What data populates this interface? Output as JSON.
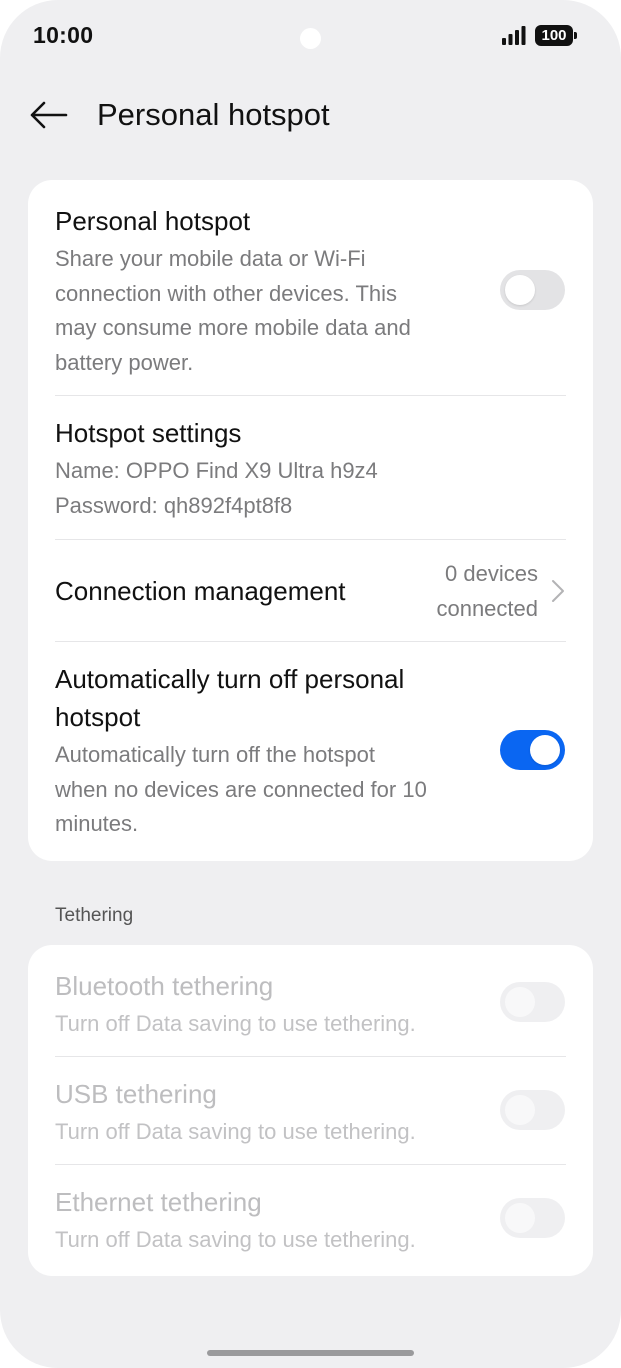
{
  "status_bar": {
    "time": "10:00",
    "battery": "100"
  },
  "header": {
    "title": "Personal hotspot"
  },
  "main": {
    "hotspot": {
      "title": "Personal hotspot",
      "description_lines": [
        "Share your mobile data or Wi-Fi",
        "connection with other devices. This",
        "may consume more mobile data and",
        "battery power."
      ],
      "enabled": false
    },
    "settings": {
      "title": "Hotspot settings",
      "name_line": "Name: OPPO Find X9 Ultra h9z4",
      "password_line": "Password: qh892f4pt8f8"
    },
    "connection": {
      "title": "Connection management",
      "value_lines": [
        "0 devices",
        "connected"
      ]
    },
    "auto_off": {
      "title_lines": [
        "Automatically turn off personal",
        "hotspot"
      ],
      "description_lines": [
        "Automatically turn off the hotspot",
        "when no devices are connected for 10",
        "minutes."
      ],
      "enabled": true
    }
  },
  "tethering": {
    "section_label": "Tethering",
    "items": [
      {
        "title": "Bluetooth tethering",
        "subtitle": "Turn off Data saving to use tethering.",
        "enabled": false
      },
      {
        "title": "USB tethering",
        "subtitle": "Turn off Data saving to use tethering.",
        "enabled": false
      },
      {
        "title": "Ethernet tethering",
        "subtitle": "Turn off Data saving to use tethering.",
        "enabled": false
      }
    ]
  },
  "colors": {
    "accent": "#0a66f2",
    "background": "#efeff1",
    "card": "#ffffff"
  },
  "icons": {
    "back": "arrow-left-icon",
    "chevron": "chevron-right-icon",
    "signal": "signal-icon",
    "battery": "battery-icon"
  }
}
